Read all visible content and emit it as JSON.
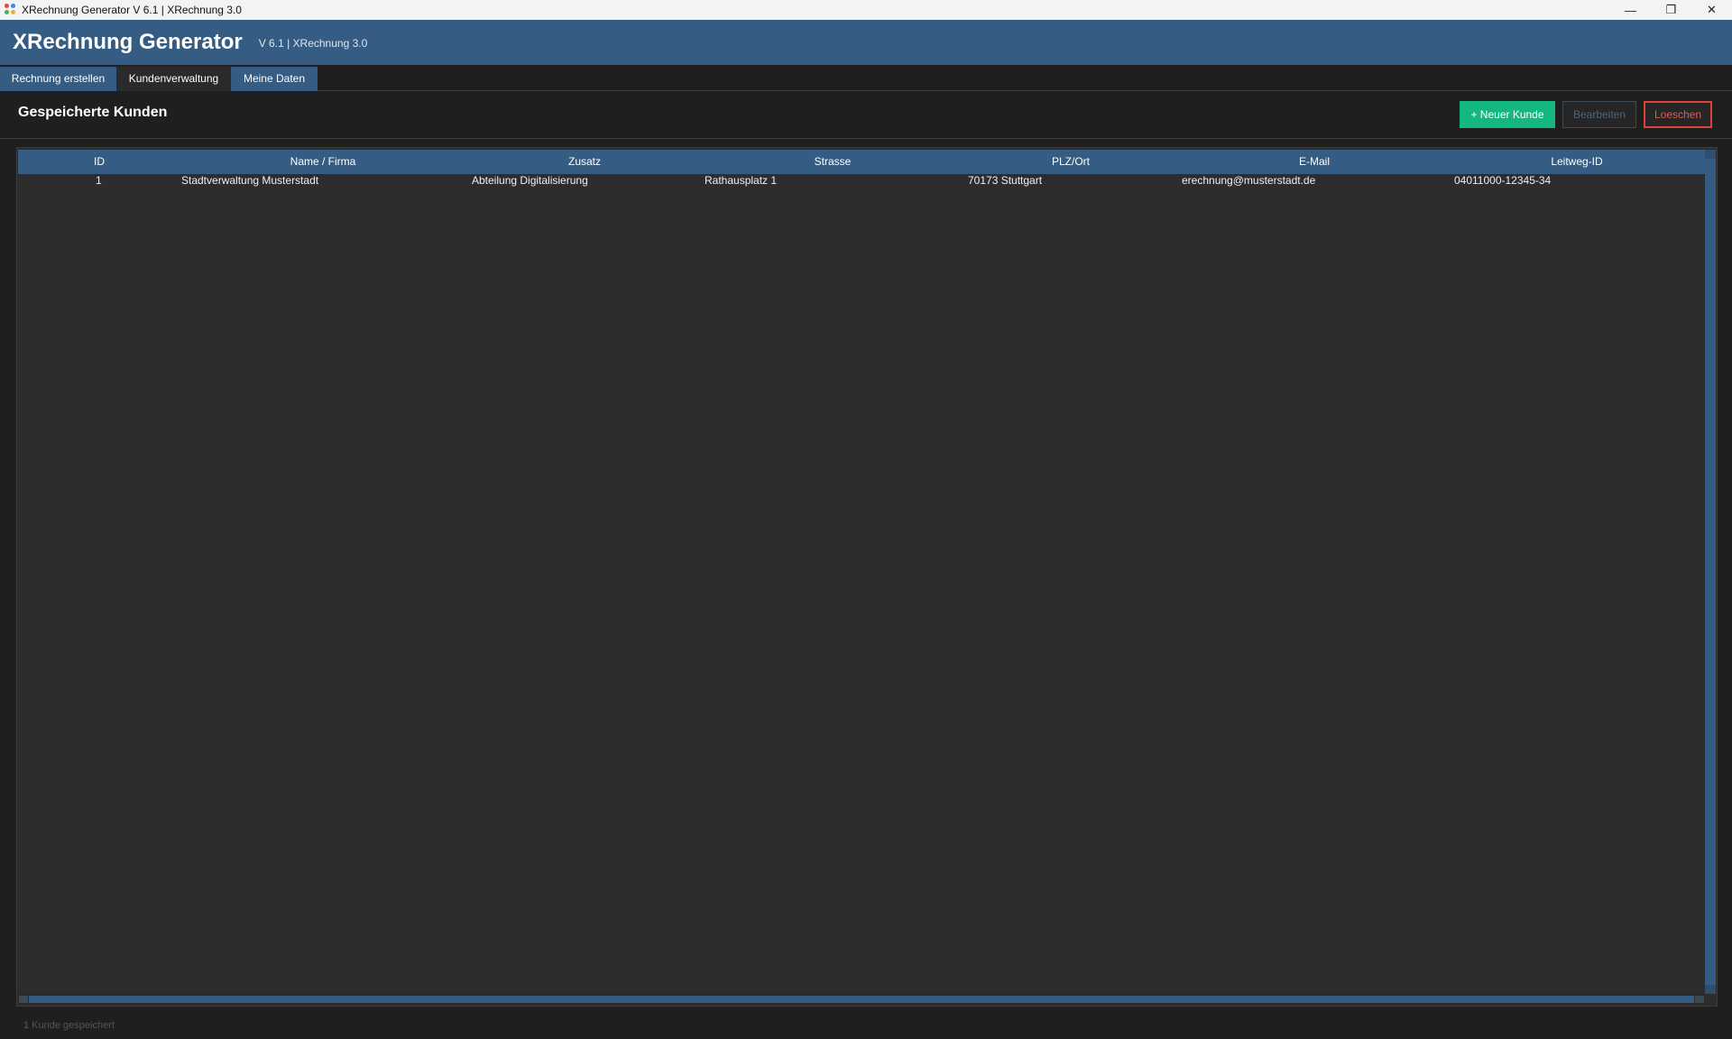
{
  "window": {
    "title": "XRechnung Generator  V 6.1  |  XRechnung 3.0",
    "controls": [
      "—",
      "❐",
      "✕"
    ]
  },
  "header": {
    "app_name": "XRechnung Generator",
    "version": "V 6.1  |  XRechnung 3.0"
  },
  "tabs": [
    {
      "label": "Rechnung erstellen",
      "active": false
    },
    {
      "label": "Kundenverwaltung",
      "active": true
    },
    {
      "label": "Meine Daten",
      "active": false
    }
  ],
  "page": {
    "title": "Gespeicherte Kunden"
  },
  "toolbar": {
    "new_label": "+ Neuer Kunde",
    "edit_label": "Bearbeiten",
    "delete_label": "Loeschen"
  },
  "table": {
    "columns": [
      "ID",
      "Name / Firma",
      "Zusatz",
      "Strasse",
      "PLZ/Ort",
      "E-Mail",
      "Leitweg-ID"
    ],
    "rows": [
      [
        "1",
        "Stadtverwaltung Musterstadt",
        "Abteilung Digitalisierung",
        "Rathausplatz 1",
        "70173 Stuttgart",
        "erechnung@musterstadt.de",
        "04011000-12345-34"
      ]
    ]
  },
  "status": {
    "text": "1 Kunde gespeichert"
  },
  "colors": {
    "accent": "#355c82",
    "success": "#14b87f",
    "danger": "#d9433a",
    "background": "#1f1f1f",
    "table_bg": "#2d2d2d"
  }
}
